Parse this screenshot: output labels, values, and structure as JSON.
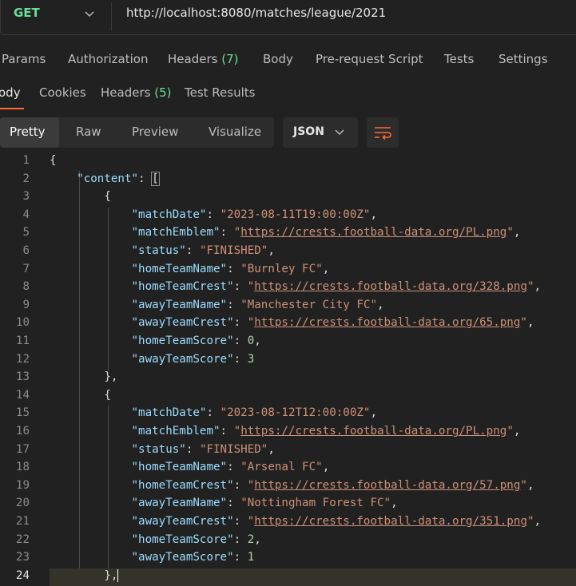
{
  "request": {
    "method": "GET",
    "url": "http://localhost:8080/matches/league/2021"
  },
  "request_tabs": [
    {
      "label": "Params"
    },
    {
      "label": "Authorization"
    },
    {
      "label": "Headers",
      "count": "(7)"
    },
    {
      "label": "Body"
    },
    {
      "label": "Pre-request Script"
    },
    {
      "label": "Tests"
    },
    {
      "label": "Settings"
    }
  ],
  "response_tabs": [
    {
      "label": "ody"
    },
    {
      "label": "Cookies"
    },
    {
      "label": "Headers",
      "count": "(5)"
    },
    {
      "label": "Test Results"
    }
  ],
  "view_modes": [
    "Pretty",
    "Raw",
    "Preview",
    "Visualize"
  ],
  "format": "JSON",
  "lines": [
    "1",
    "2",
    "3",
    "4",
    "5",
    "6",
    "7",
    "8",
    "9",
    "10",
    "11",
    "12",
    "13",
    "14",
    "15",
    "16",
    "17",
    "18",
    "19",
    "20",
    "21",
    "22",
    "23",
    "24"
  ],
  "json": {
    "content_key": "\"content\"",
    "m1": {
      "matchDate": "\"2023-08-11T19:00:00Z\"",
      "matchEmblem": "https://crests.football-data.org/PL.png",
      "status": "\"FINISHED\"",
      "homeTeamName": "\"Burnley FC\"",
      "homeTeamCrest": "https://crests.football-data.org/328.png",
      "awayTeamName": "\"Manchester City FC\"",
      "awayTeamCrest": "https://crests.football-data.org/65.png",
      "homeTeamScore": "0",
      "awayTeamScore": "3"
    },
    "m2": {
      "matchDate": "\"2023-08-12T12:00:00Z\"",
      "matchEmblem": "https://crests.football-data.org/PL.png",
      "status": "\"FINISHED\"",
      "homeTeamName": "\"Arsenal FC\"",
      "homeTeamCrest": "https://crests.football-data.org/57.png",
      "awayTeamName": "\"Nottingham Forest FC\"",
      "awayTeamCrest": "https://crests.football-data.org/351.png",
      "homeTeamScore": "2",
      "awayTeamScore": "1"
    },
    "keys": {
      "matchDate": "\"matchDate\"",
      "matchEmblem": "\"matchEmblem\"",
      "status": "\"status\"",
      "homeTeamName": "\"homeTeamName\"",
      "homeTeamCrest": "\"homeTeamCrest\"",
      "awayTeamName": "\"awayTeamName\"",
      "awayTeamCrest": "\"awayTeamCrest\"",
      "homeTeamScore": "\"homeTeamScore\"",
      "awayTeamScore": "\"awayTeamScore\""
    }
  },
  "colors": {
    "method": "#6bdd9a",
    "accent": "#ff6c37",
    "key": "#9cdcfe",
    "string": "#ce9178",
    "number": "#b5cea8"
  }
}
